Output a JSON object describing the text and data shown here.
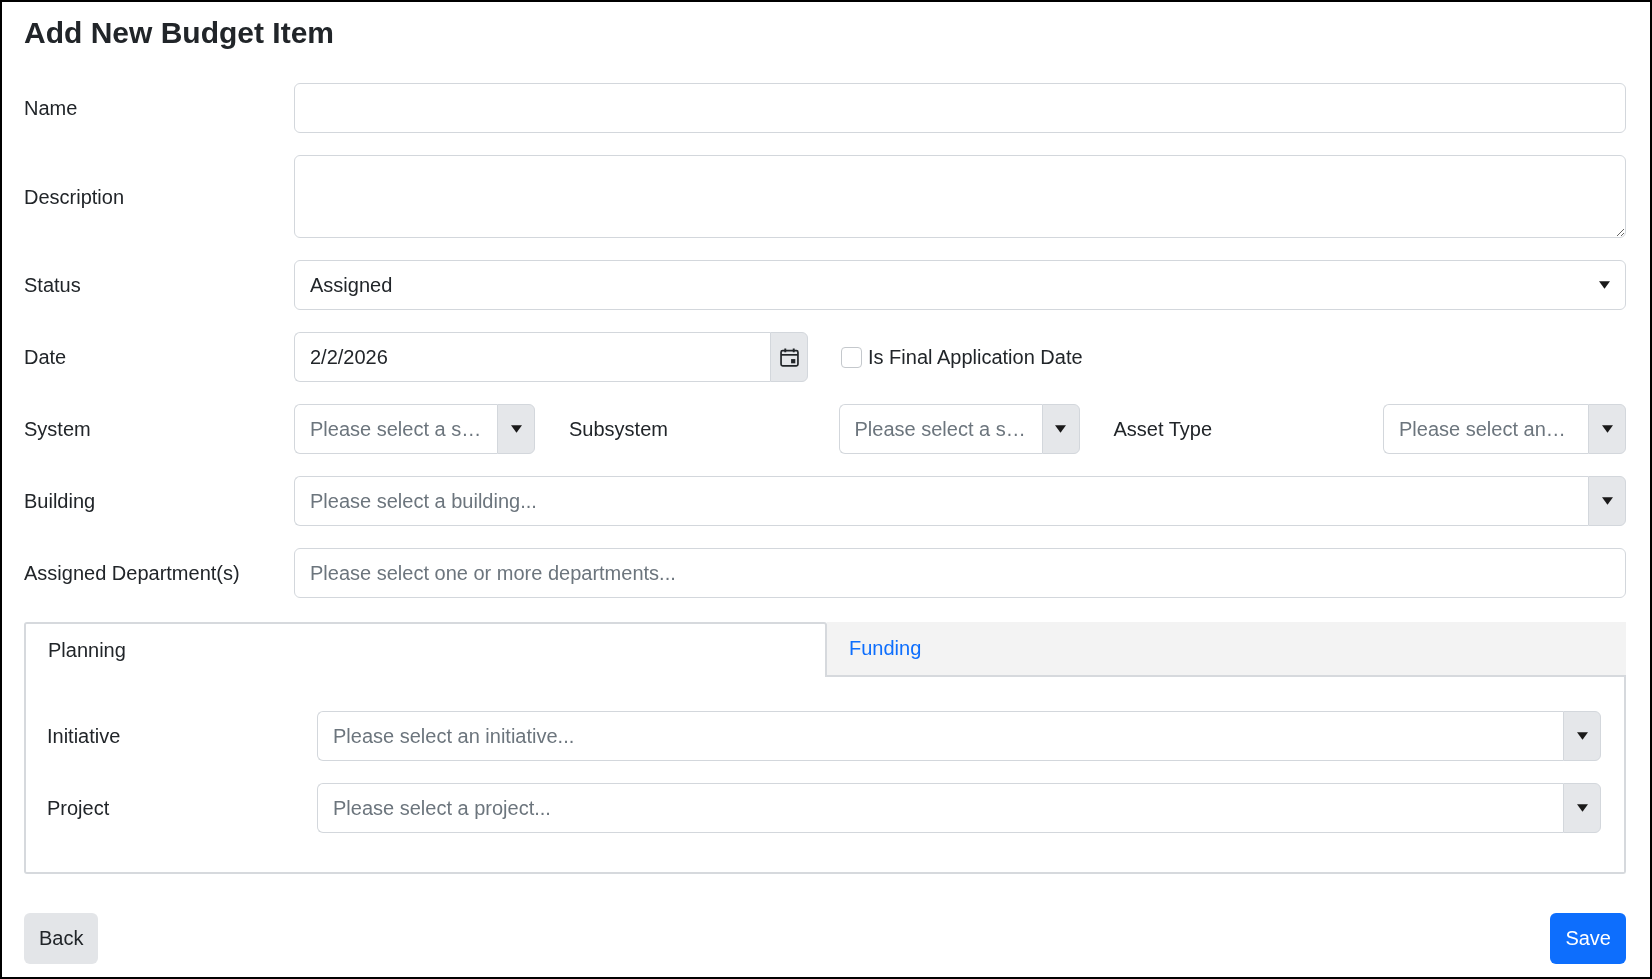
{
  "title": "Add New Budget Item",
  "fields": [
    {
      "kind": "text",
      "label": "Name"
    },
    {
      "kind": "textarea",
      "label": "Description"
    },
    {
      "kind": "select",
      "label": "Status",
      "value": "Assigned"
    },
    {
      "kind": "date",
      "label": "Date",
      "value": "2/2/2026",
      "option": {
        "label": "Is Final Application Date",
        "checked": false
      }
    },
    {
      "kind": "combo_row",
      "items": [
        {
          "label": "System",
          "placeholder": "Please select a s…"
        },
        {
          "label": "Subsystem",
          "placeholder": "Please select a s…"
        },
        {
          "label": "Asset Type",
          "placeholder": "Please select an…"
        }
      ]
    },
    {
      "kind": "combo",
      "label": "Building",
      "placeholder": "Please select a building..."
    },
    {
      "kind": "multiselect",
      "label": "Assigned Department(s)",
      "placeholder": "Please select one or more departments..."
    }
  ],
  "tabs": [
    {
      "label": "Planning",
      "selected": true
    },
    {
      "label": "Funding",
      "selected": false
    }
  ],
  "panel_fields": [
    {
      "kind": "combo",
      "label": "Initiative",
      "placeholder": "Please select an initiative..."
    },
    {
      "kind": "combo",
      "label": "Project",
      "placeholder": "Please select a project..."
    }
  ],
  "buttons": [
    {
      "kind": "secondary",
      "label": "Back"
    },
    {
      "kind": "primary",
      "label": "Save"
    }
  ]
}
